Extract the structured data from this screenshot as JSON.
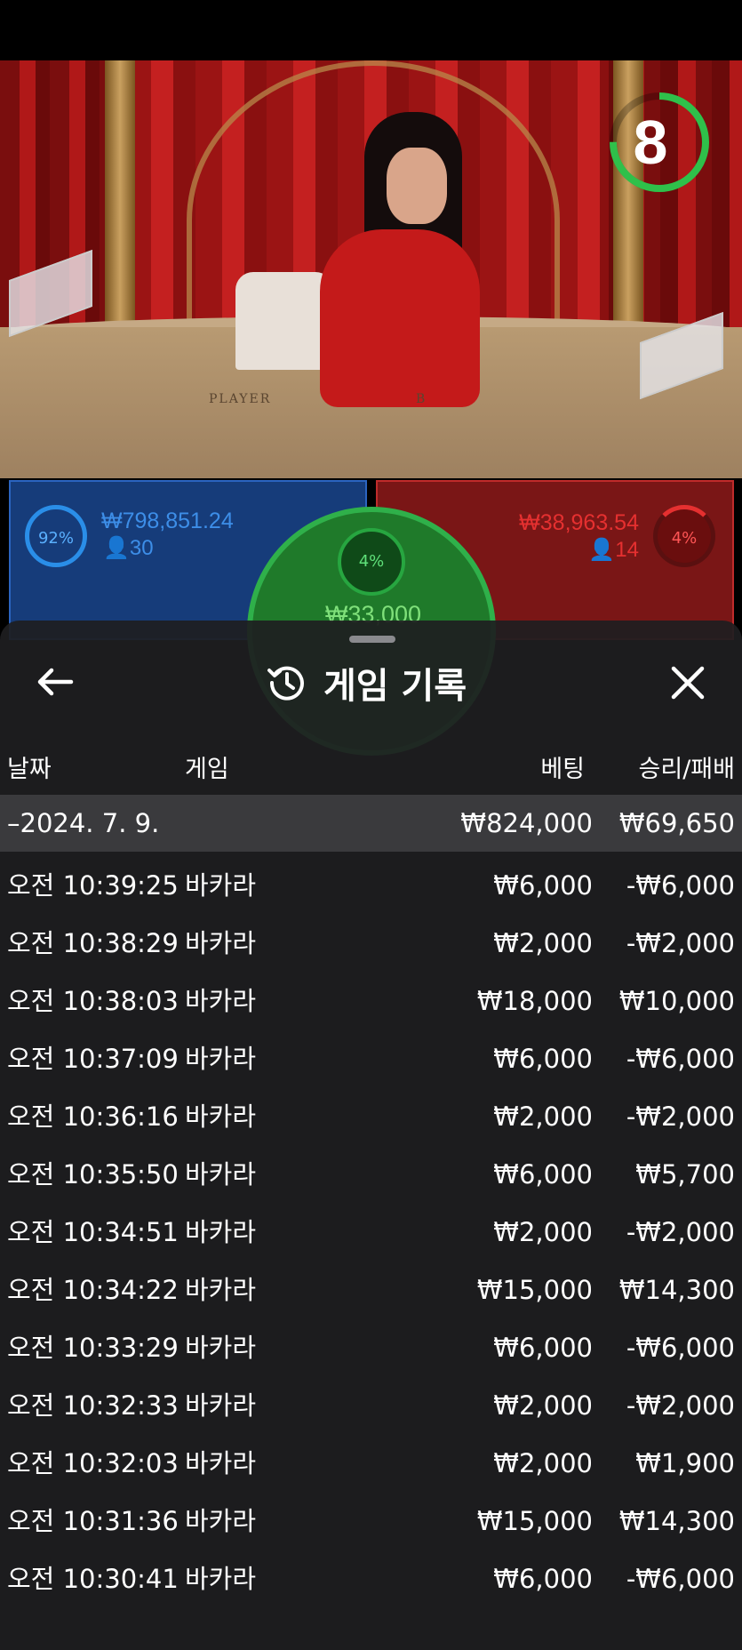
{
  "timer": {
    "value": "8",
    "fraction": 0.75
  },
  "table": {
    "player_text": "PLAYER",
    "banker_text": "B"
  },
  "bets": {
    "player": {
      "percent": "92%",
      "amount": "₩798,851.24",
      "count": "30"
    },
    "banker": {
      "percent": "4%",
      "amount": "₩38,963.54",
      "count": "14"
    },
    "tie": {
      "percent": "4%",
      "amount": "₩33,000"
    }
  },
  "history": {
    "title": "게임 기록",
    "columns": {
      "date": "날짜",
      "game": "게임",
      "bet": "베팅",
      "result": "승리/패배"
    },
    "summary": {
      "date": "–2024. 7. 9.",
      "bet": "₩824,000",
      "result": "₩69,650"
    },
    "rows": [
      {
        "date": "오전 10:39:25",
        "game": "바카라",
        "bet": "₩6,000",
        "result": "-₩6,000"
      },
      {
        "date": "오전 10:38:29",
        "game": "바카라",
        "bet": "₩2,000",
        "result": "-₩2,000"
      },
      {
        "date": "오전 10:38:03",
        "game": "바카라",
        "bet": "₩18,000",
        "result": "₩10,000"
      },
      {
        "date": "오전 10:37:09",
        "game": "바카라",
        "bet": "₩6,000",
        "result": "-₩6,000"
      },
      {
        "date": "오전 10:36:16",
        "game": "바카라",
        "bet": "₩2,000",
        "result": "-₩2,000"
      },
      {
        "date": "오전 10:35:50",
        "game": "바카라",
        "bet": "₩6,000",
        "result": "₩5,700"
      },
      {
        "date": "오전 10:34:51",
        "game": "바카라",
        "bet": "₩2,000",
        "result": "-₩2,000"
      },
      {
        "date": "오전 10:34:22",
        "game": "바카라",
        "bet": "₩15,000",
        "result": "₩14,300"
      },
      {
        "date": "오전 10:33:29",
        "game": "바카라",
        "bet": "₩6,000",
        "result": "-₩6,000"
      },
      {
        "date": "오전 10:32:33",
        "game": "바카라",
        "bet": "₩2,000",
        "result": "-₩2,000"
      },
      {
        "date": "오전 10:32:03",
        "game": "바카라",
        "bet": "₩2,000",
        "result": "₩1,900"
      },
      {
        "date": "오전 10:31:36",
        "game": "바카라",
        "bet": "₩15,000",
        "result": "₩14,300"
      },
      {
        "date": "오전 10:30:41",
        "game": "바카라",
        "bet": "₩6,000",
        "result": "-₩6,000"
      }
    ]
  }
}
